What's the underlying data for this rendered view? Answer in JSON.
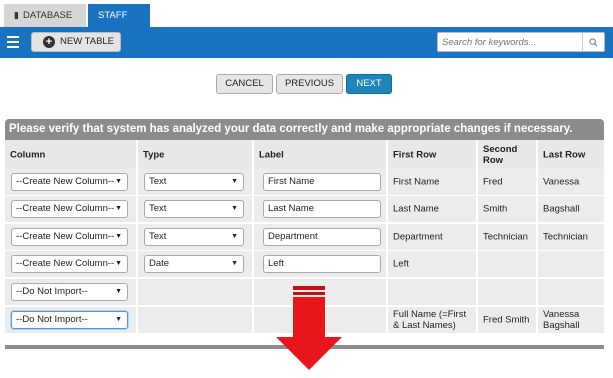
{
  "tabs": [
    {
      "label": "DATABASE",
      "icon": "database-icon"
    },
    {
      "label": "STAFF",
      "icon": "pin-icon"
    }
  ],
  "toolbar": {
    "new_table_label": "NEW TABLE",
    "search_placeholder": "Search for keywords..."
  },
  "nav": {
    "cancel": "CANCEL",
    "previous": "PREVIOUS",
    "next": "NEXT"
  },
  "verify_message": "Please verify that system has analyzed your data correctly and make appropriate changes if necessary.",
  "table": {
    "headers": [
      "Column",
      "Type",
      "Label",
      "First Row",
      "Second Row",
      "Last Row"
    ],
    "rows": [
      {
        "column": "--Create New Column--",
        "type": "Text",
        "label": "First Name",
        "first": "First Name",
        "second": "Fred",
        "last": "Vanessa"
      },
      {
        "column": "--Create New Column--",
        "type": "Text",
        "label": "Last Name",
        "first": "Last Name",
        "second": "Smith",
        "last": "Bagshall"
      },
      {
        "column": "--Create New Column--",
        "type": "Text",
        "label": "Department",
        "first": "Department",
        "second": "Technician",
        "last": "Technician"
      },
      {
        "column": "--Create New Column--",
        "type": "Date",
        "label": "Left",
        "first": "Left",
        "second": "",
        "last": ""
      },
      {
        "column": "--Do Not Import--",
        "type": "",
        "label": "",
        "first": "",
        "second": "",
        "last": ""
      },
      {
        "column": "--Do Not Import--",
        "type": "",
        "label": "",
        "first": "Full Name (=First & Last Names)",
        "second": "Fred Smith",
        "last": "Vanessa Bagshall"
      }
    ]
  },
  "colors": {
    "accent": "#1a73c0",
    "next_button": "#1d85b7",
    "banner": "#8c8c8c",
    "arrow": "#e8161b"
  }
}
